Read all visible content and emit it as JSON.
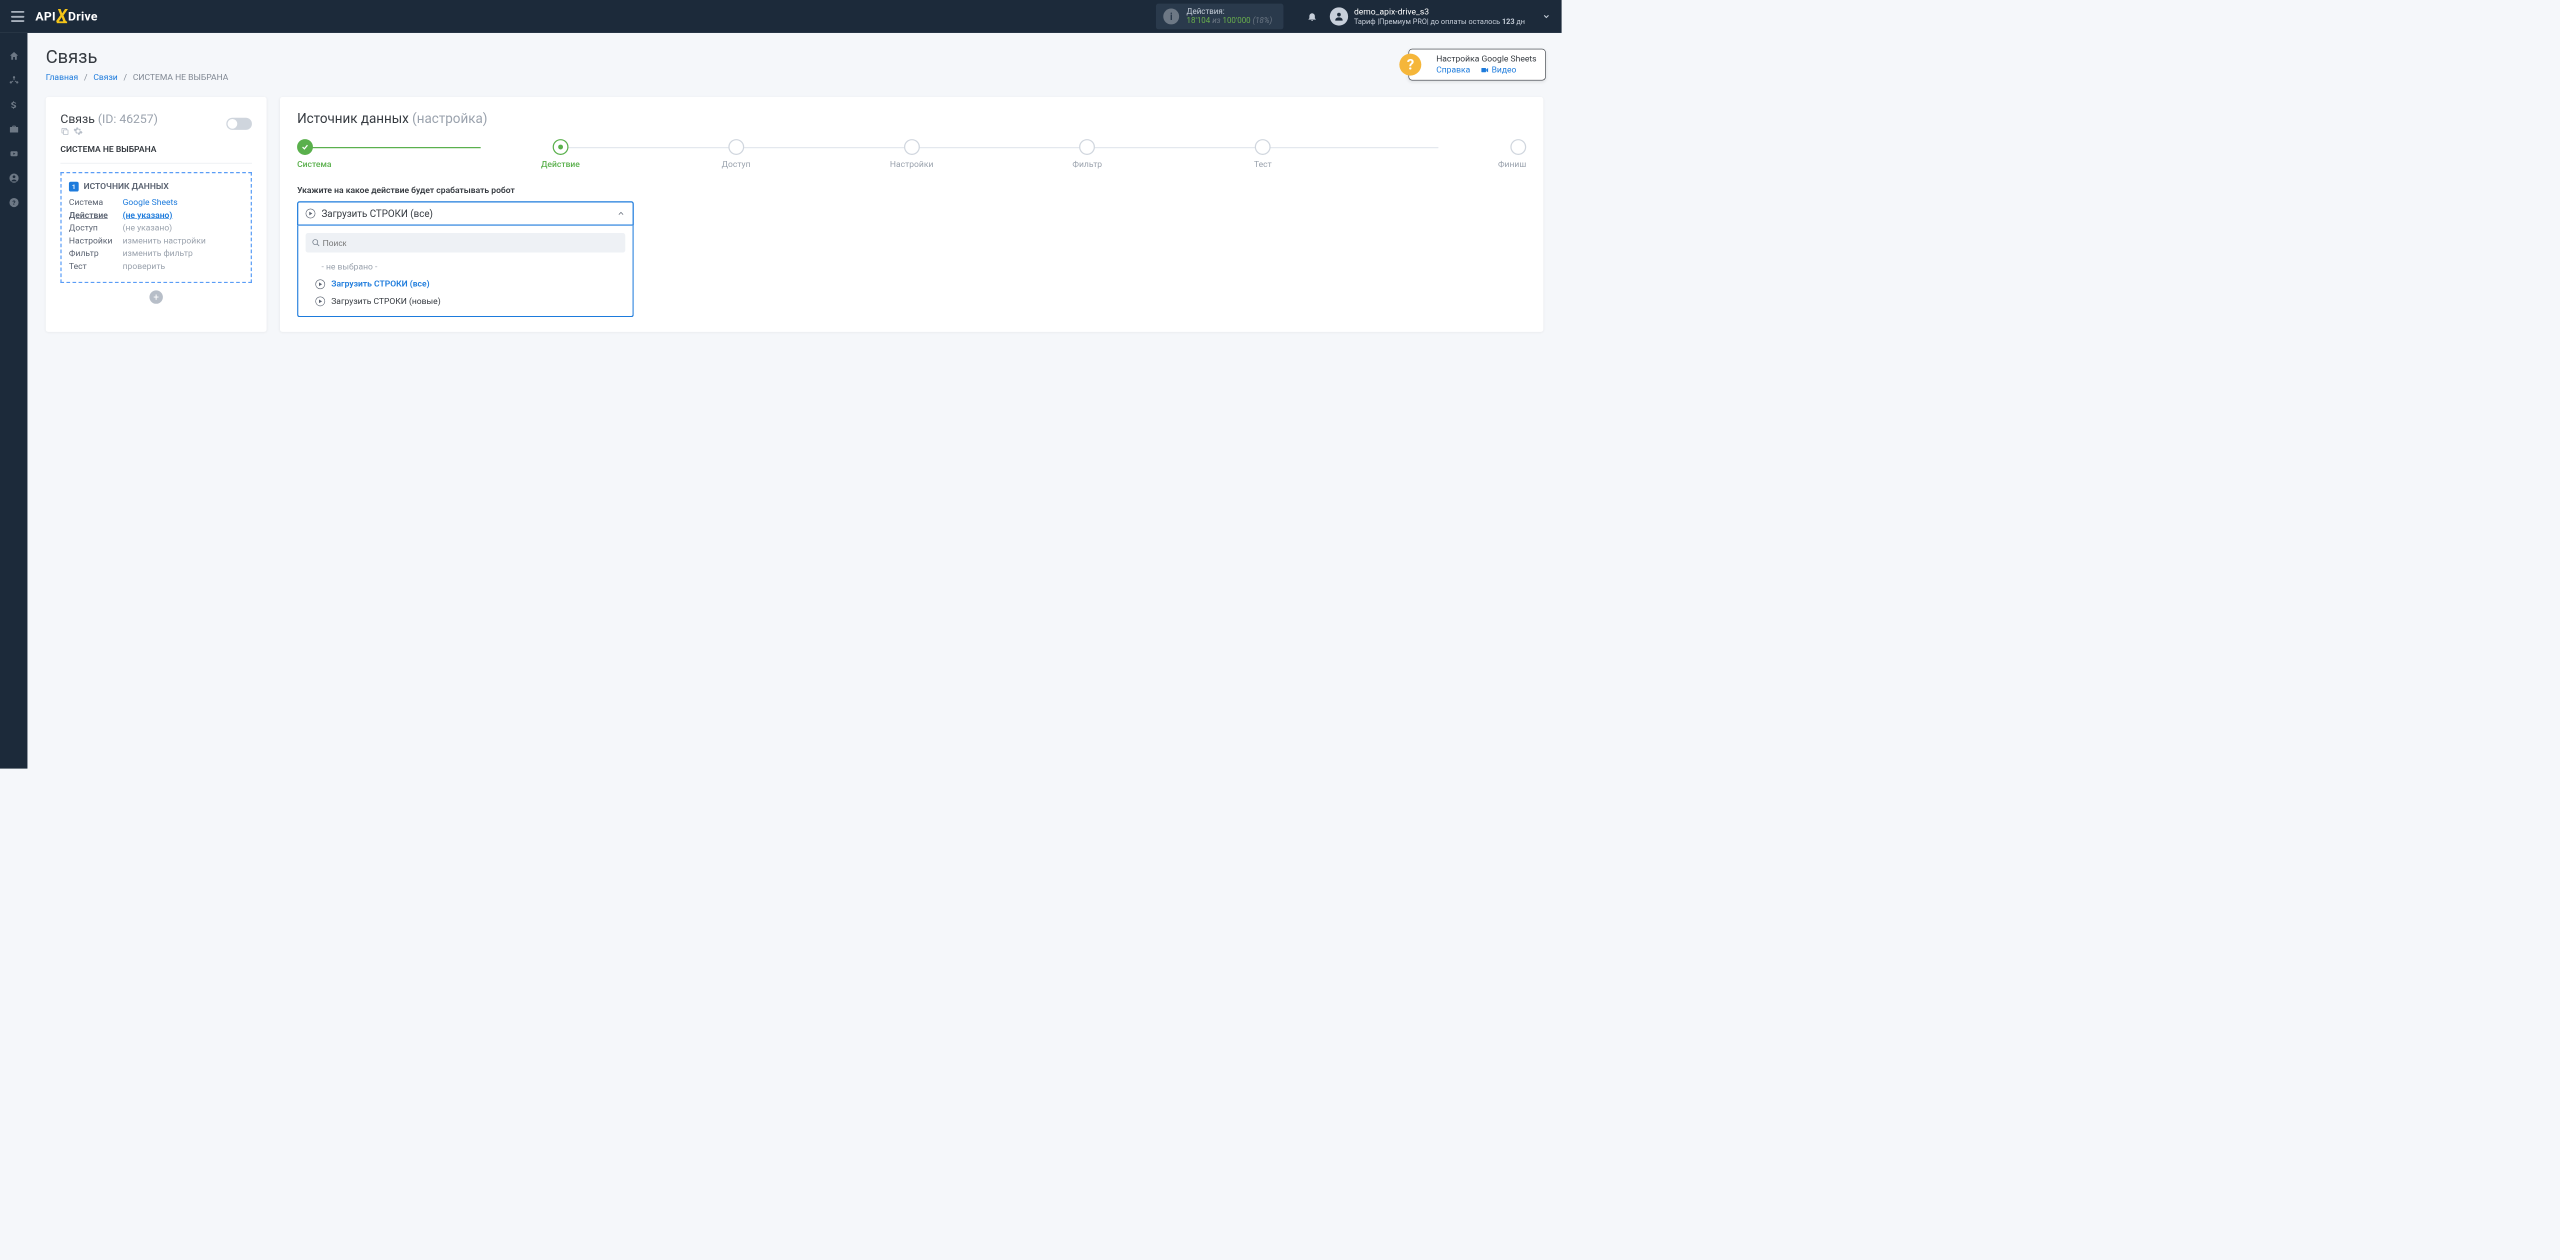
{
  "header": {
    "actions_label": "Действия:",
    "actions_count": "18'104",
    "actions_of": "из",
    "actions_total": "100'000",
    "actions_percent": "(18%)",
    "user_name": "demo_apix-drive_s3",
    "tariff_prefix": "Тариф |Премиум PRO|  до оплаты осталось ",
    "tariff_days": "123",
    "tariff_suffix": " дн"
  },
  "page": {
    "title": "Связь",
    "crumb_home": "Главная",
    "crumb_links": "Связи",
    "crumb_current": "СИСТЕМА НЕ ВЫБРАНА"
  },
  "help": {
    "title": "Настройка Google Sheets",
    "ref": "Справка",
    "video": "Видео"
  },
  "left": {
    "title_prefix": "Связь",
    "id_label": "(ID: 46257)",
    "subtitle": "СИСТЕМА НЕ ВЫБРАНА",
    "source_head": "ИСТОЧНИК ДАННЫХ",
    "rows": {
      "system_k": "Система",
      "system_v": "Google Sheets",
      "action_k": "Действие",
      "action_v": "(не указано)",
      "access_k": "Доступ",
      "access_v": "(не указано)",
      "settings_k": "Настройки",
      "settings_v": "изменить настройки",
      "filter_k": "Фильтр",
      "filter_v": "изменить фильтр",
      "test_k": "Тест",
      "test_v": "проверить"
    }
  },
  "right": {
    "title": "Источник данных",
    "title_sub": "(настройка)",
    "steps": [
      "Система",
      "Действие",
      "Доступ",
      "Настройки",
      "Фильтр",
      "Тест",
      "Финиш"
    ],
    "field_label": "Укажите на какое действие будет срабатывать робот",
    "selected": "Загрузить СТРОКИ (все)",
    "search_placeholder": "Поиск",
    "opt_none": "- не выбрано -",
    "opt_all": "Загрузить СТРОКИ (все)",
    "opt_new": "Загрузить СТРОКИ (новые)"
  }
}
